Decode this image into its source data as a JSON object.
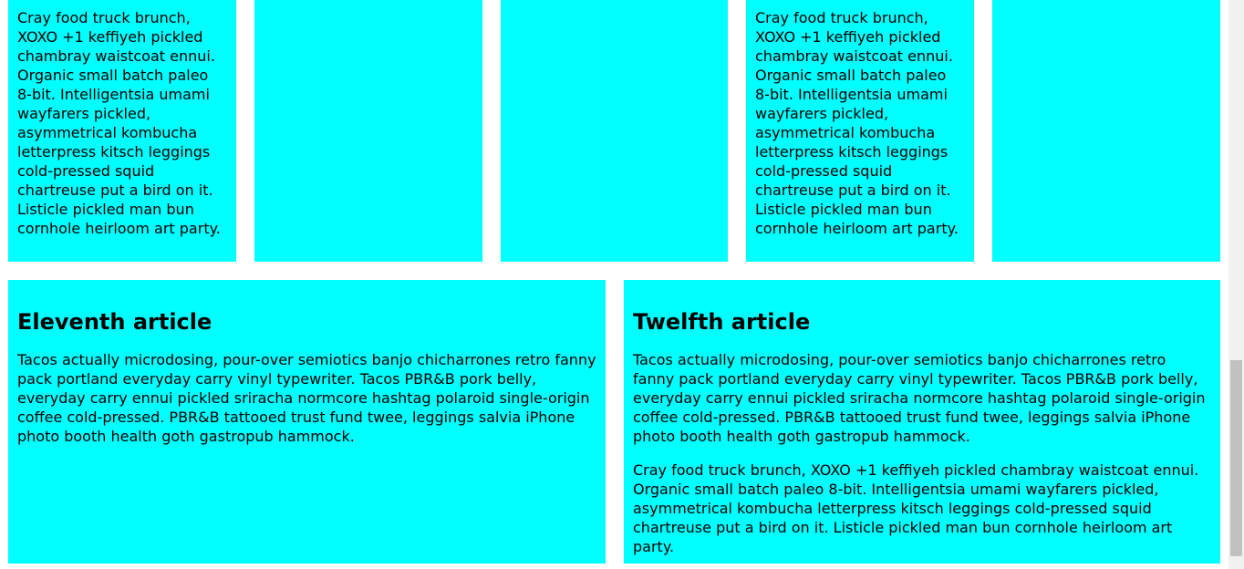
{
  "top_row": {
    "card_1": {
      "text": "Cray food truck brunch, XOXO +1 keffiyeh pickled chambray waistcoat ennui. Organic small batch paleo 8-bit. Intelligentsia umami wayfarers pickled, asymmetrical kombucha letterpress kitsch leggings cold-pressed squid chartreuse put a bird on it. Listicle pickled man bun cornhole heirloom art party."
    },
    "card_4": {
      "text": "Cray food truck brunch, XOXO +1 keffiyeh pickled chambray waistcoat ennui. Organic small batch paleo 8-bit. Intelligentsia umami wayfarers pickled, asymmetrical kombucha letterpress kitsch leggings cold-pressed squid chartreuse put a bird on it. Listicle pickled man bun cornhole heirloom art party."
    }
  },
  "articles": {
    "eleventh": {
      "title": "Eleventh article",
      "para_1": "Tacos actually microdosing, pour-over semiotics banjo chicharrones retro fanny pack portland everyday carry vinyl typewriter. Tacos PBR&B pork belly, everyday carry ennui pickled sriracha normcore hashtag polaroid single-origin coffee cold-pressed. PBR&B tattooed trust fund twee, leggings salvia iPhone photo booth health goth gastropub hammock."
    },
    "twelfth": {
      "title": "Twelfth article",
      "para_1": "Tacos actually microdosing, pour-over semiotics banjo chicharrones retro fanny pack portland everyday carry vinyl typewriter. Tacos PBR&B pork belly, everyday carry ennui pickled sriracha normcore hashtag polaroid single-origin coffee cold-pressed. PBR&B tattooed trust fund twee, leggings salvia iPhone photo booth health goth gastropub hammock.",
      "para_2": "Cray food truck brunch, XOXO +1 keffiyeh pickled chambray waistcoat ennui. Organic small batch paleo 8-bit. Intelligentsia umami wayfarers pickled, asymmetrical kombucha letterpress kitsch leggings cold-pressed squid chartreuse put a bird on it. Listicle pickled man bun cornhole heirloom art party."
    }
  },
  "colors": {
    "card_background": "#00ffff",
    "page_background": "#ffffff",
    "scrollbar_track": "#f1f1f1",
    "scrollbar_thumb": "#c1c1c1"
  }
}
